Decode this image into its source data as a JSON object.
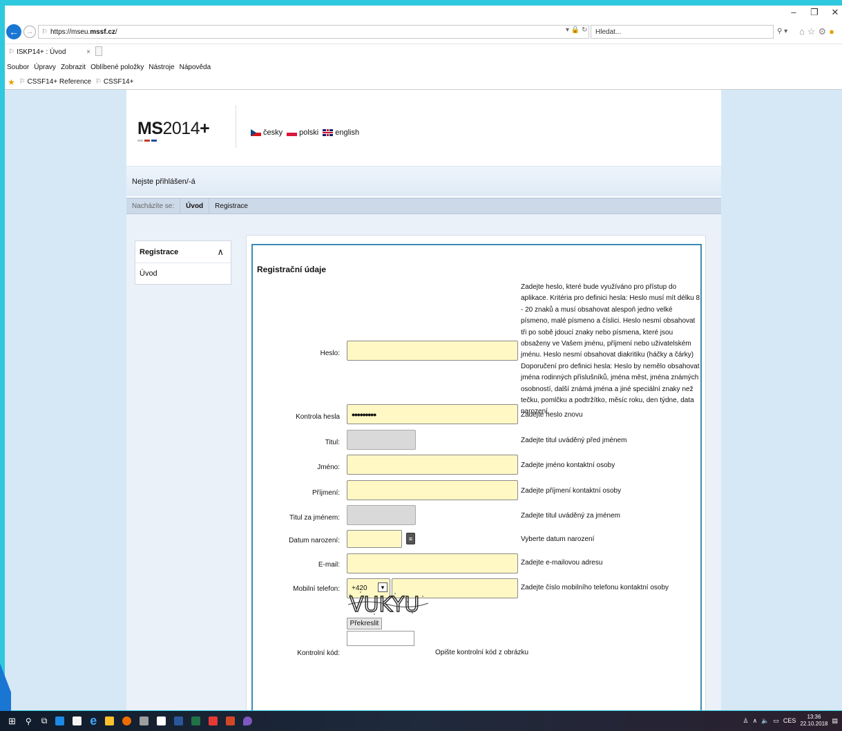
{
  "browser": {
    "url_prefix": "https://mseu.",
    "url_domain": "mssf.cz",
    "url_suffix": "/",
    "search_placeholder": "Hledat...",
    "tab_title": "ISKP14+ : Úvod",
    "menu": [
      "Soubor",
      "Úpravy",
      "Zobrazit",
      "Oblíbené položky",
      "Nástroje",
      "Nápověda"
    ],
    "favorites": [
      "CSSF14+ Reference",
      "CSSF14+"
    ]
  },
  "header": {
    "logo_bold": "MS",
    "logo_rest": "2014",
    "logo_plus": "+",
    "languages": [
      "česky",
      "polski",
      "english"
    ]
  },
  "status": "Nejste přihlášen/-á",
  "breadcrumb": {
    "label": "Nacházíte se:",
    "items": [
      "Úvod",
      "Registrace"
    ]
  },
  "sidebar": {
    "title": "Registrace",
    "items": [
      "Úvod"
    ]
  },
  "form": {
    "title": "Registrační údaje",
    "password_label": "Heslo:",
    "password_hint": "Zadejte heslo, které bude využíváno pro přístup do aplikace. Kritéria pro definici hesla: Heslo musí mít délku 8 - 20 znaků a musí obsahovat alespoň jedno velké písmeno, malé písmeno a číslici. Heslo nesmí obsahovat tři po sobě jdoucí znaky nebo písmena, které jsou obsaženy ve Vašem jménu, příjmení nebo uživatelském jménu. Heslo nesmí obsahovat diakritiku (háčky a čárky) Doporučení pro definici hesla: Heslo by nemělo obsahovat jména rodinných příslušníků, jména měst, jména známých osobností, další známá jména a jiné speciální znaky než tečku, pomlčku a podtržítko, měsíc roku, den týdne, data narození.",
    "confirm_label": "Kontrola hesla",
    "confirm_value": "•••••••••",
    "confirm_hint": "Zadejte heslo znovu",
    "title_before_label": "Titul:",
    "title_before_hint": "Zadejte titul uváděný před jménem",
    "firstname_label": "Jméno:",
    "firstname_hint": "Zadejte jméno kontaktní osoby",
    "lastname_label": "Příjmení:",
    "lastname_hint": "Zadejte příjmení kontaktní osoby",
    "title_after_label": "Titul za jménem:",
    "title_after_hint": "Zadejte titul uváděný za jménem",
    "dob_label": "Datum narození:",
    "dob_hint": "Vyberte datum narození",
    "email_label": "E-mail:",
    "email_hint": "Zadejte e-mailovou adresu",
    "phone_label": "Mobilní telefon:",
    "phone_prefix": "+420",
    "phone_hint": "Zadejte číslo mobilního telefonu kontaktní osoby",
    "captcha_text": "VUKYU",
    "redraw_label": "Překreslit",
    "code_label": "Kontrolní kód:",
    "code_hint": "Opište kontrolní kód z obrázku"
  },
  "taskbar": {
    "lang": "CES",
    "time": "13:36",
    "date": "22.10.2018"
  },
  "colors": {
    "input_yellow": "#fff8c4",
    "frame_blue": "#3c8ab2",
    "page_bg": "#d6e8f6"
  }
}
